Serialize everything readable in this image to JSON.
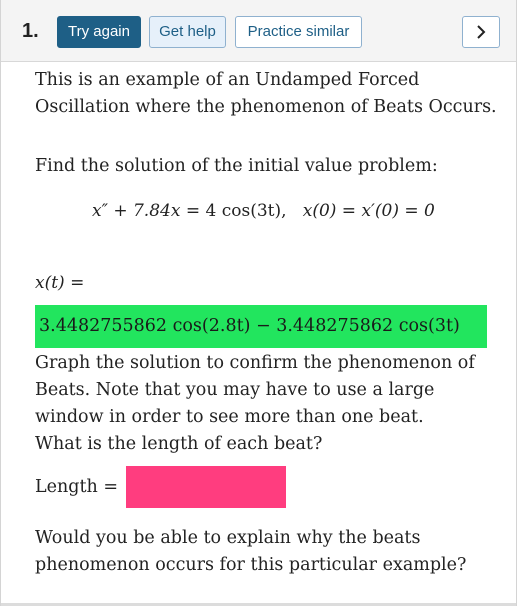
{
  "header": {
    "question_number": "1.",
    "try_again_label": "Try again",
    "get_help_label": "Get help",
    "practice_similar_label": "Practice similar",
    "next_icon": "chevron-right-icon"
  },
  "problem": {
    "intro": "This is an example of an Undamped Forced Oscillation where the phenomenon of Beats Occurs.",
    "find_text": "Find the solution of the initial value problem:",
    "equation_lhs": "x″ + 7.84x",
    "equation_eq": " = 4 cos(3t),",
    "initial_conditions": "x(0) = x′(0) = 0",
    "solution_label": "x(t) =",
    "solution_value": "3.4482755862 cos(2.8t) − 3.448275862 cos(3t)",
    "graph_text": "Graph the solution to confirm the phenomenon of Beats. Note that you may have to use a large window in order to see more than one beat.",
    "beat_question": "What is the length of each beat?",
    "length_label": "Length =",
    "length_value": "",
    "explain_question": "Would you be able to explain why the beats phenomenon occurs for this particular example?"
  },
  "colors": {
    "primary": "#1e5f86",
    "correct_answer_bg": "#22e55e",
    "incorrect_answer_bg": "#ff3d7f"
  }
}
